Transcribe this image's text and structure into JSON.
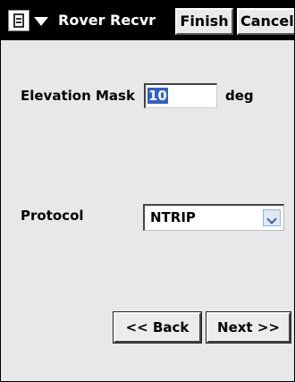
{
  "titlebar": {
    "title": "Rover Recvr",
    "finish_label": "Finish",
    "cancel_label": "Cancel",
    "menu_icon": "document-menu-icon"
  },
  "form": {
    "elevation_mask_label": "Elevation Mask",
    "elevation_mask_value": "10",
    "elevation_unit": "deg",
    "protocol_label": "Protocol",
    "protocol_value": "NTRIP"
  },
  "navigation": {
    "back_label": "<< Back",
    "next_label": "Next >>"
  },
  "colors": {
    "titlebar_bg": "#000000",
    "selection_highlight": "#3060c8",
    "background": "#e8e8e8"
  }
}
